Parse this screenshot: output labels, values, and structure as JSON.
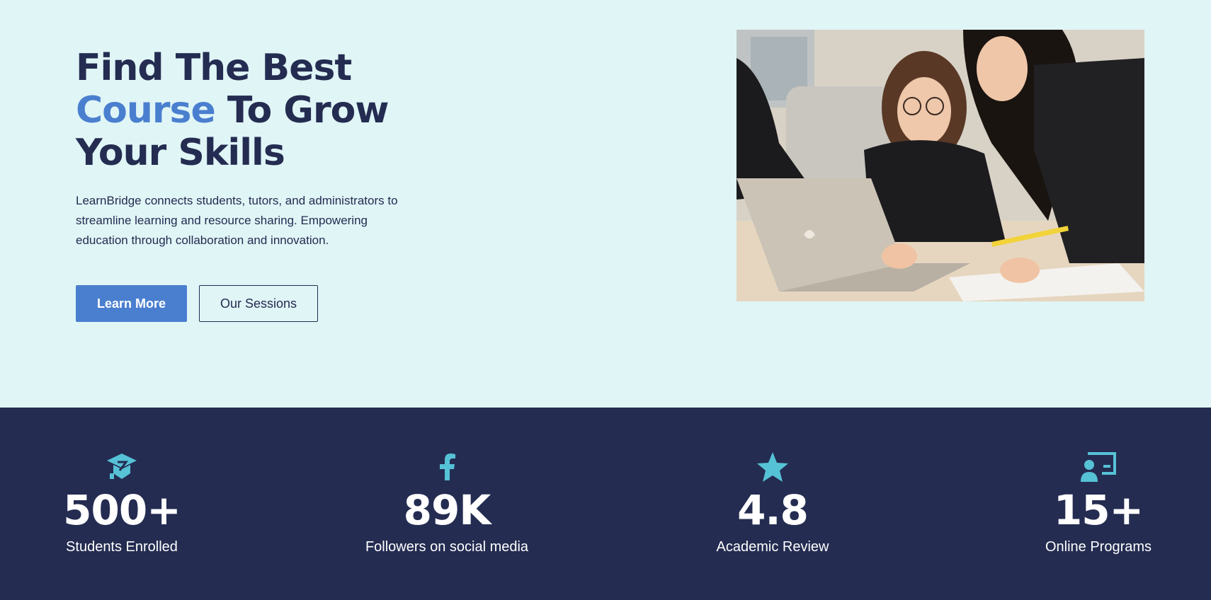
{
  "hero": {
    "headline": {
      "line1": "Find The Best",
      "accent": "Course",
      "line2_rest": " To Grow",
      "line3": "Your Skills"
    },
    "description": "LearnBridge connects students, tutors, and administrators to streamline learning and resource sharing. Empowering education through collaboration and innovation.",
    "primary_button": "Learn More",
    "secondary_button": "Our Sessions",
    "image_icon": "students-with-laptop-photo"
  },
  "stats": [
    {
      "icon": "graduation-cap-icon",
      "value": "500+",
      "label": "Students Enrolled"
    },
    {
      "icon": "facebook-icon",
      "value": "89K",
      "label": "Followers on social media"
    },
    {
      "icon": "star-icon",
      "value": "4.8",
      "label": "Academic Review"
    },
    {
      "icon": "teacher-board-icon",
      "value": "15+",
      "label": "Online Programs"
    }
  ],
  "colors": {
    "hero_bg": "#e0f5f6",
    "navy": "#242c51",
    "accent_blue": "#4a7fcf",
    "icon_teal": "#56c2d6"
  }
}
